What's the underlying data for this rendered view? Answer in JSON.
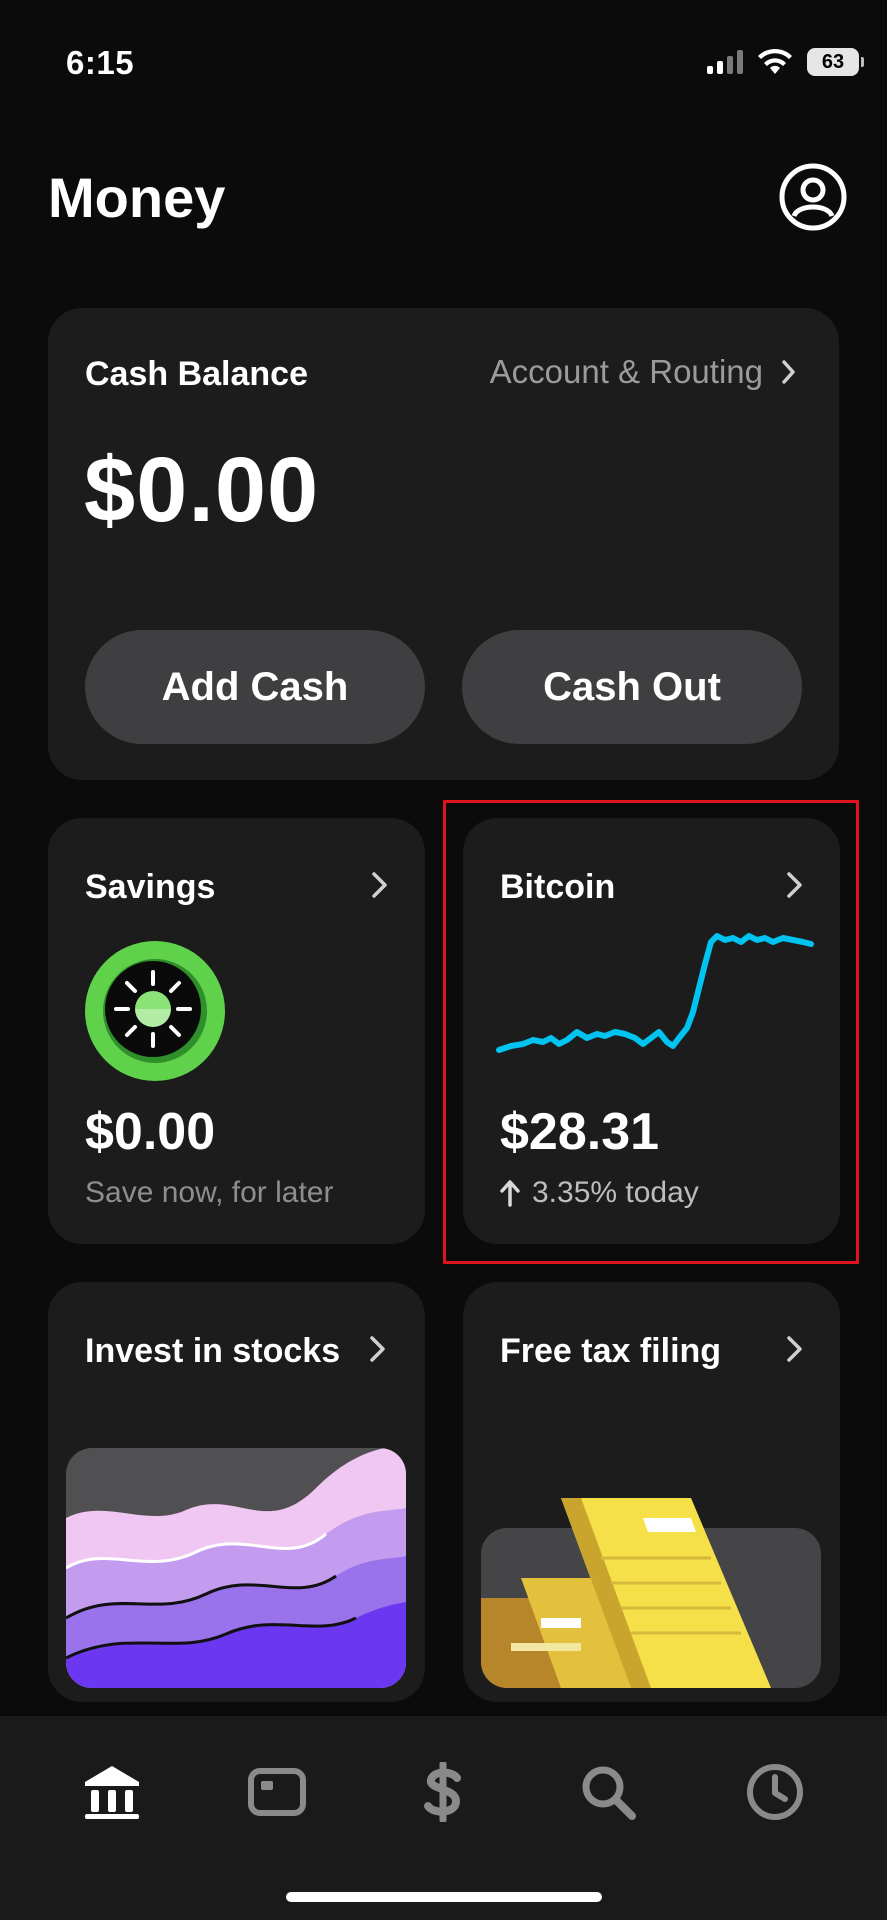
{
  "status_bar": {
    "time": "6:15",
    "battery": "63"
  },
  "header": {
    "title": "Money"
  },
  "cash_balance": {
    "title": "Cash Balance",
    "account_link": "Account & Routing",
    "amount": "$0.00",
    "add_cash_label": "Add Cash",
    "cash_out_label": "Cash Out"
  },
  "savings": {
    "title": "Savings",
    "amount": "$0.00",
    "subtitle": "Save now, for later"
  },
  "bitcoin": {
    "title": "Bitcoin",
    "amount": "$28.31",
    "change": "3.35% today"
  },
  "invest": {
    "title": "Invest in stocks"
  },
  "tax": {
    "title": "Free tax filing"
  },
  "nav": {
    "items": [
      "home-icon",
      "card-icon",
      "dollar-icon",
      "search-icon",
      "clock-icon"
    ],
    "active": "home-icon"
  },
  "colors": {
    "background": "#0b0b0b",
    "card": "#1c1c1c",
    "button": "#3f3f41",
    "bitcoin_line": "#00c3f0",
    "savings_green": "#5fd14a",
    "highlight": "#e0141e"
  }
}
